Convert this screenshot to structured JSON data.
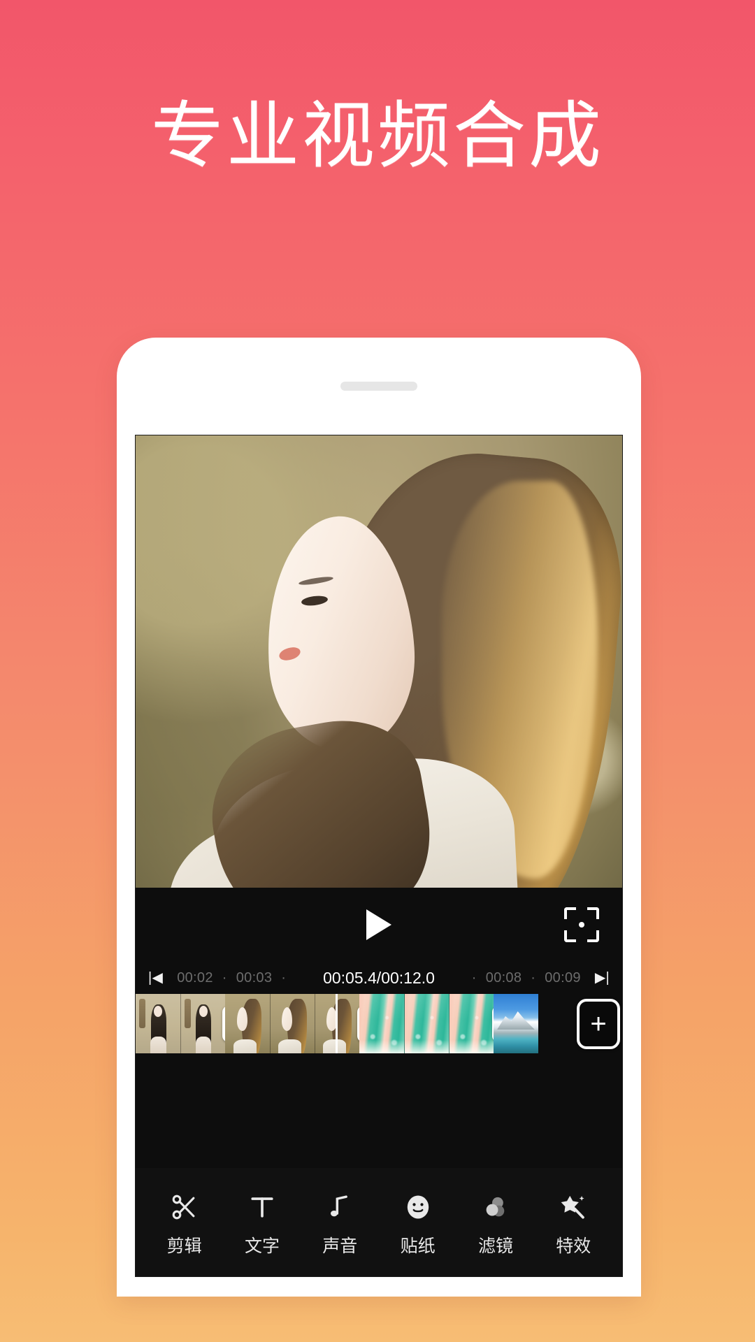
{
  "headline": "专业视频合成",
  "theme": {
    "gradient_top": "#F2566A",
    "gradient_bottom": "#F7BD74",
    "screen_bg": "#0D0D0D",
    "accent_white": "#FFFFFF"
  },
  "phone": {
    "speaker_name": "earpiece-speaker"
  },
  "player": {
    "play_icon": "play-icon",
    "crop_icon": "fullscreen-crop-icon",
    "preview_alt": "portrait of woman in profile with long hair, white coat, golden field background"
  },
  "ruler": {
    "prev_marker": "|◀",
    "next_marker": "▶|",
    "left_ticks": [
      "00:02",
      "00:03"
    ],
    "right_ticks": [
      "00:08",
      "00:09"
    ],
    "dot": "·",
    "current_time": "00:05.4",
    "separator": "/",
    "total_time": "00:12.0",
    "current_over_total": "00:05.4/00:12.0"
  },
  "timeline": {
    "transition_label": "+",
    "add_clip_label": "+",
    "playhead_name": "playhead",
    "clips": [
      {
        "id": "clip-1",
        "art": "artA",
        "frames": 2
      },
      {
        "id": "clip-2",
        "art": "artB",
        "frames": 3
      },
      {
        "id": "clip-3",
        "art": "artC",
        "frames": 3
      },
      {
        "id": "clip-4",
        "art": "artD",
        "frames": 1
      }
    ]
  },
  "toolbar": {
    "items": [
      {
        "label": "剪辑",
        "icon": "scissors-icon"
      },
      {
        "label": "文字",
        "icon": "text-t-icon"
      },
      {
        "label": "声音",
        "icon": "music-note-icon"
      },
      {
        "label": "贴纸",
        "icon": "smiley-sticker-icon"
      },
      {
        "label": "滤镜",
        "icon": "filter-circles-icon"
      },
      {
        "label": "特效",
        "icon": "magic-wand-star-icon"
      }
    ]
  }
}
